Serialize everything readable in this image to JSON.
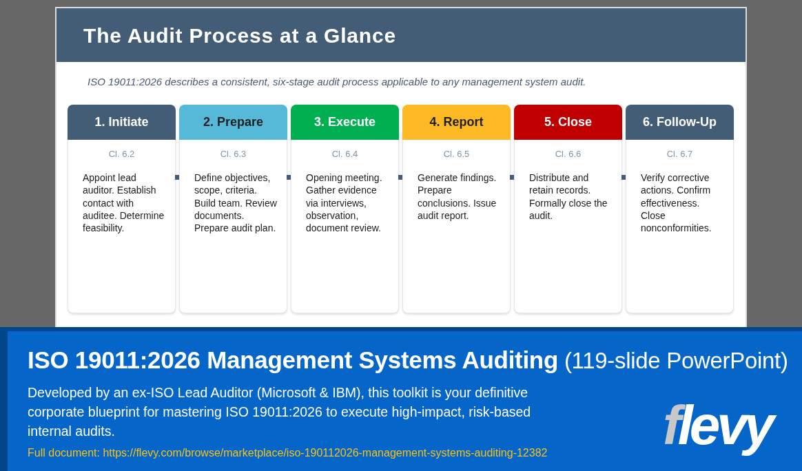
{
  "slide": {
    "title": "The Audit Process at a Glance",
    "subtitle": "ISO 19011:2026 describes a consistent, six-stage audit process applicable to any management system audit.",
    "stages": [
      {
        "title": "1. Initiate",
        "clause": "Cl. 6.2",
        "description": "Appoint lead auditor. Establish contact with auditee. Determine feasibility.",
        "color": "#445d76"
      },
      {
        "title": "2. Prepare",
        "clause": "Cl. 6.3",
        "description": "Define objectives, scope, criteria. Build team. Review documents. Prepare audit plan.",
        "color": "#56b9d8"
      },
      {
        "title": "3. Execute",
        "clause": "Cl. 6.4",
        "description": "Opening meeting. Gather evidence via interviews, observation, document review.",
        "color": "#00b050"
      },
      {
        "title": "4. Report",
        "clause": "Cl. 6.5",
        "description": "Generate findings. Prepare conclusions. Issue audit report.",
        "color": "#fdb924"
      },
      {
        "title": "5. Close",
        "clause": "Cl. 6.6",
        "description": "Distribute and retain records. Formally close the audit.",
        "color": "#c00000"
      },
      {
        "title": "6. Follow-Up",
        "clause": "Cl. 6.7",
        "description": "Verify corrective actions. Confirm effectiveness. Close nonconformities.",
        "color": "#445d76"
      }
    ]
  },
  "banner": {
    "title": "**ISO 19011:2026 Management Systems Auditing** (119-slide PowerPoint)",
    "description": "Developed by an ex-ISO Lead Auditor (Microsoft & IBM), this toolkit is your definitive corporate blueprint for mastering ISO 19011:2026 to execute high-impact, risk-based internal audits.",
    "link": "Full document: https://flevy.com/browse/marketplace/iso-190112026-management-systems-auditing-12382",
    "logo": "flevy"
  }
}
